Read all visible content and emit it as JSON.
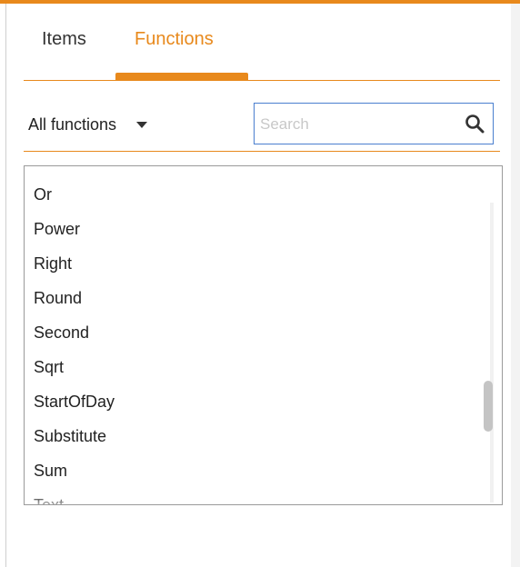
{
  "tabs": [
    {
      "label": "Items",
      "active": false
    },
    {
      "label": "Functions",
      "active": true
    }
  ],
  "filter": {
    "selected_category": "All functions",
    "search_placeholder": "Search",
    "search_value": ""
  },
  "functions_list": [
    "Or",
    "Power",
    "Right",
    "Round",
    "Second",
    "Sqrt",
    "StartOfDay",
    "Substitute",
    "Sum",
    "Text"
  ],
  "colors": {
    "accent": "#e8891c",
    "search_border": "#4a7fcf",
    "text": "#222222"
  },
  "icons": {
    "search": "search-icon",
    "dropdown": "caret-down-icon"
  }
}
